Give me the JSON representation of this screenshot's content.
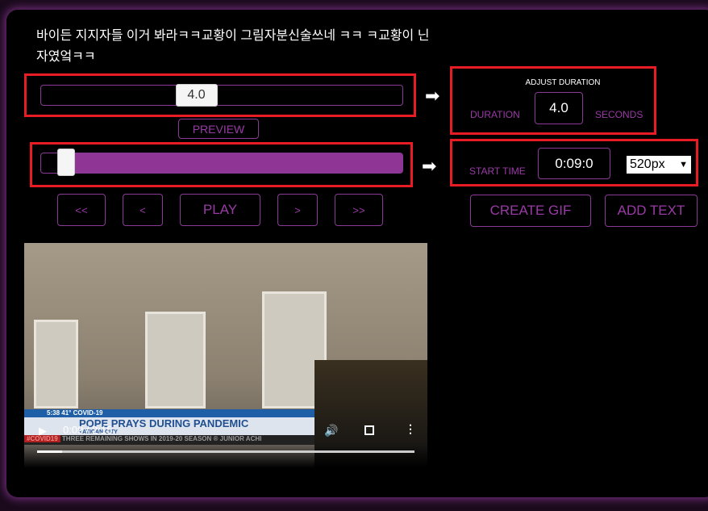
{
  "title": "바이든 지지자들 이거 봐라ㅋㅋ교황이 그림자분신술쓰네 ㅋㅋ ㅋ교황이 닌자였엌ㅋㅋ",
  "duration_slider": {
    "value": "4.0",
    "fraction": 0.43
  },
  "preview_label": "PREVIEW",
  "start_slider": {
    "fraction": 0.07
  },
  "adjust": {
    "heading": "ADJUST DURATION",
    "duration_label": "DURATION",
    "value": "4.0",
    "seconds_label": "SECONDS"
  },
  "start": {
    "label": "START TIME",
    "value": "0:09:0",
    "size": "520px"
  },
  "nav": {
    "first": "<<",
    "prev": "<",
    "play": "PLAY",
    "next": ">",
    "last": ">>"
  },
  "actions": {
    "create_gif": "CREATE GIF",
    "add_text": "ADD TEXT"
  },
  "video": {
    "time": "0:09 / 2:15",
    "progress": 0.067,
    "ticker_time": "5:38",
    "temp": "41°",
    "topic": "COVID-19",
    "headline": "POPE PRAYS DURING PANDEMIC",
    "sub": "VATICAN CITY",
    "tag": "#COVID19",
    "crawl": "THREE REMAINING SHOWS IN 2019-20 SEASON   ®   JUNIOR ACHI"
  },
  "colors": {
    "accent": "#9a3aa6",
    "red": "#e81c24"
  }
}
